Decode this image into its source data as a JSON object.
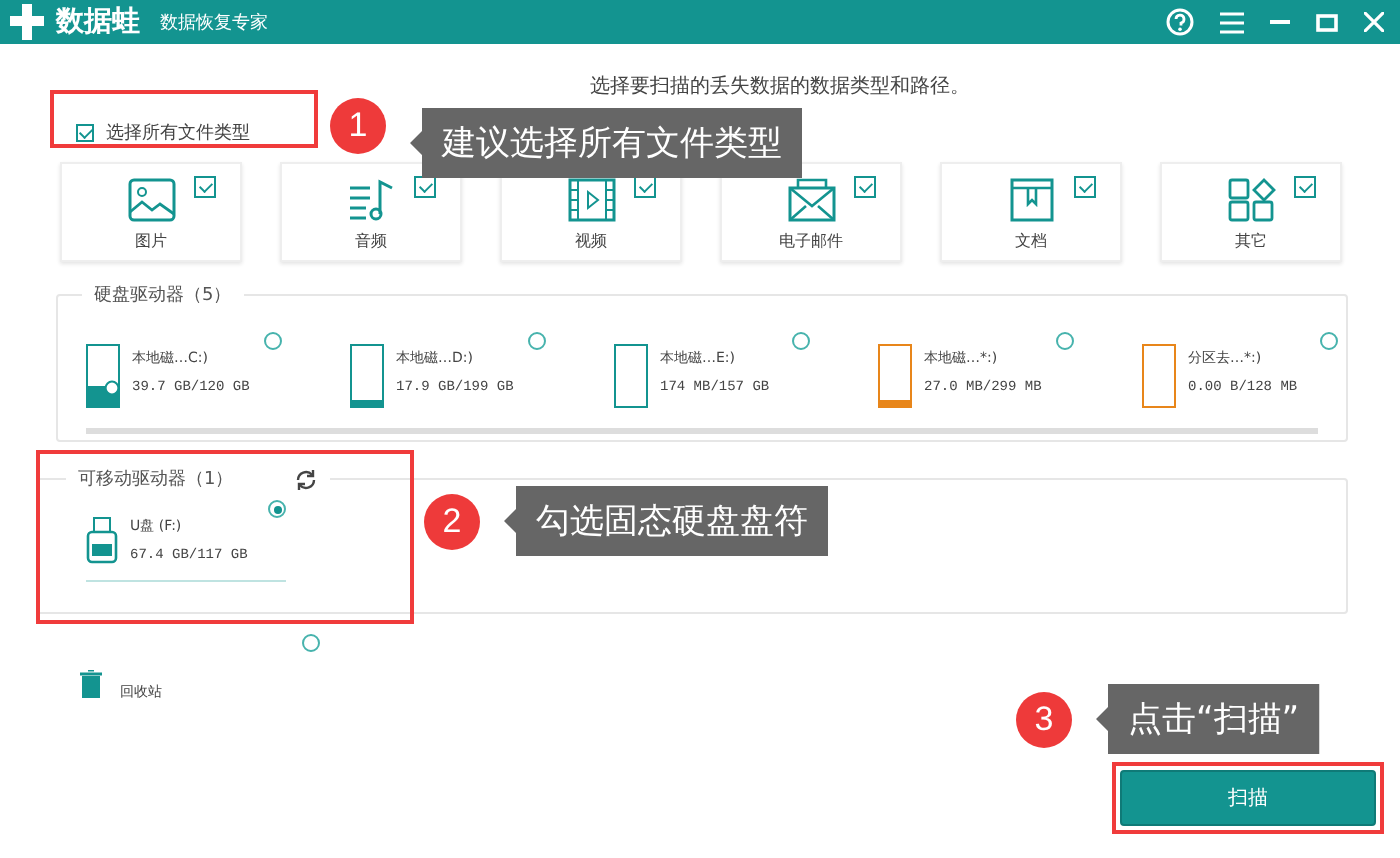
{
  "window": {
    "logo": "数据蛙",
    "subtitle": "数据恢复专家"
  },
  "instruction": "选择要扫描的丢失数据的数据类型和路径。",
  "select_all": {
    "label": "选择所有文件类型",
    "checked": true
  },
  "file_types": [
    {
      "kind": "image",
      "label": "图片",
      "checked": true
    },
    {
      "kind": "audio",
      "label": "音频",
      "checked": true
    },
    {
      "kind": "video",
      "label": "视频",
      "checked": true
    },
    {
      "kind": "email",
      "label": "电子邮件",
      "checked": true
    },
    {
      "kind": "document",
      "label": "文档",
      "checked": true
    },
    {
      "kind": "other",
      "label": "其它",
      "checked": true
    }
  ],
  "hard_drives": {
    "title": "硬盘驱动器（5）",
    "items": [
      {
        "name": "本地磁…C:)",
        "size": "39.7 GB/120 GB",
        "level": 0.33,
        "color": "#139490",
        "system": true,
        "selected": false
      },
      {
        "name": "本地磁…D:)",
        "size": "17.9 GB/199 GB",
        "level": 0.09,
        "color": "#139490",
        "system": false,
        "selected": false
      },
      {
        "name": "本地磁…E:)",
        "size": "174 MB/157 GB",
        "level": 0,
        "color": "#139490",
        "system": false,
        "selected": false
      },
      {
        "name": "本地磁…*:)",
        "size": "27.0 MB/299 MB",
        "level": 0.09,
        "color": "#e8861a",
        "system": false,
        "selected": false
      },
      {
        "name": "分区去…*:)",
        "size": "0.00  B/128 MB",
        "level": 0,
        "color": "#e8861a",
        "system": false,
        "selected": false
      }
    ]
  },
  "removable_drives": {
    "title": "可移动驱动器（1）",
    "items": [
      {
        "name": "U盘 (F:)",
        "size": "67.4 GB/117 GB",
        "selected": true
      }
    ]
  },
  "recycle_bin": {
    "label": "回收站",
    "selected": false
  },
  "scan_button": "扫描",
  "annotations": [
    {
      "number": "1",
      "text": "建议选择所有文件类型"
    },
    {
      "number": "2",
      "text": "勾选固态硬盘盘符"
    },
    {
      "number": "3",
      "text": "点击“扫描”"
    }
  ]
}
